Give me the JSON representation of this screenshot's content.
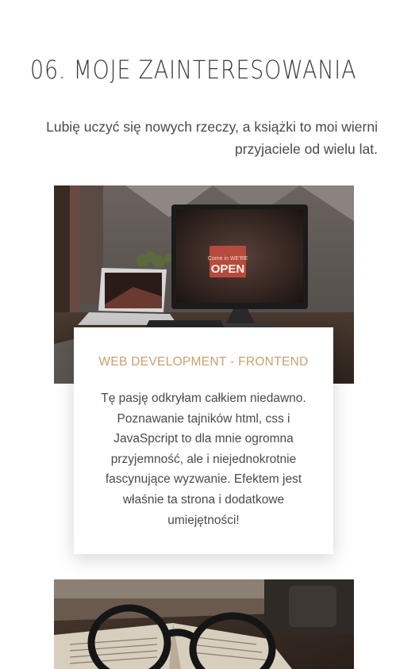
{
  "section": {
    "title": "06. MOJE ZAINTERESOWANIA",
    "intro": "Lubię uczyć się nowych rzeczy, a książki to moi wierni przyjaciele od wielu lat."
  },
  "hobbies": [
    {
      "photo_text": {
        "sign_small": "Come in WE'RE",
        "sign_big": "OPEN"
      },
      "title": "WEB DEVELOPMENT - FRONTEND",
      "description": "Tę pasję odkryłam całkiem niedawno. Poznawanie tajników html, css i JavaSpcript to dla mnie ogromna przyjemność, ale i niejednokrotnie fascynujące wyzwanie. Efektem jest właśnie ta strona i dodatkowe umiejętności!"
    }
  ],
  "colors": {
    "accent": "#c9a06b",
    "text": "#4a4a4a",
    "heading": "#3a3a3a"
  }
}
